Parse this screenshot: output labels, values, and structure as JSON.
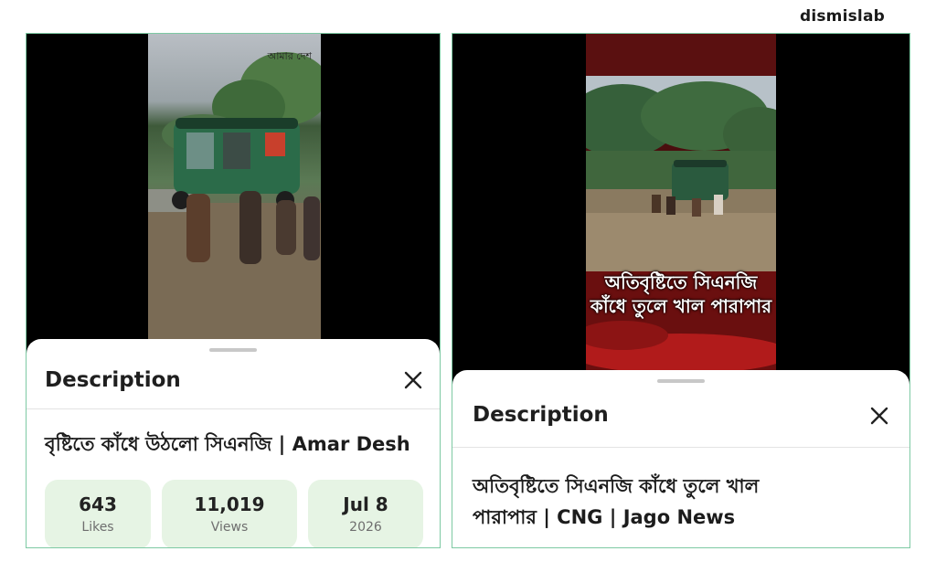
{
  "brand": "dismislab",
  "left": {
    "watermark": "আমার দেশ",
    "sheet_title": "Description",
    "description": "বৃষ্টিতে কাঁধে উঠলো সিএনজি | Amar Desh",
    "stats": [
      {
        "value": "643",
        "label": "Likes"
      },
      {
        "value": "11,019",
        "label": "Views"
      },
      {
        "value": "Jul 8",
        "label": "2026"
      }
    ]
  },
  "right": {
    "overlay_line1": "অতিবৃষ্টিতে সিএনজি",
    "overlay_line2": "কাঁধে তুলে খাল পারাপার",
    "sheet_title": "Description",
    "description_line1": "অতিবৃষ্টিতে সিএনজি কাঁধে তুলে খাল",
    "description_line2": "পারাপার | CNG | Jago News"
  },
  "colors": {
    "panel_border": "#7dc9a3",
    "stat_bg": "#e6f4e4"
  },
  "icons": [
    "close-icon"
  ]
}
